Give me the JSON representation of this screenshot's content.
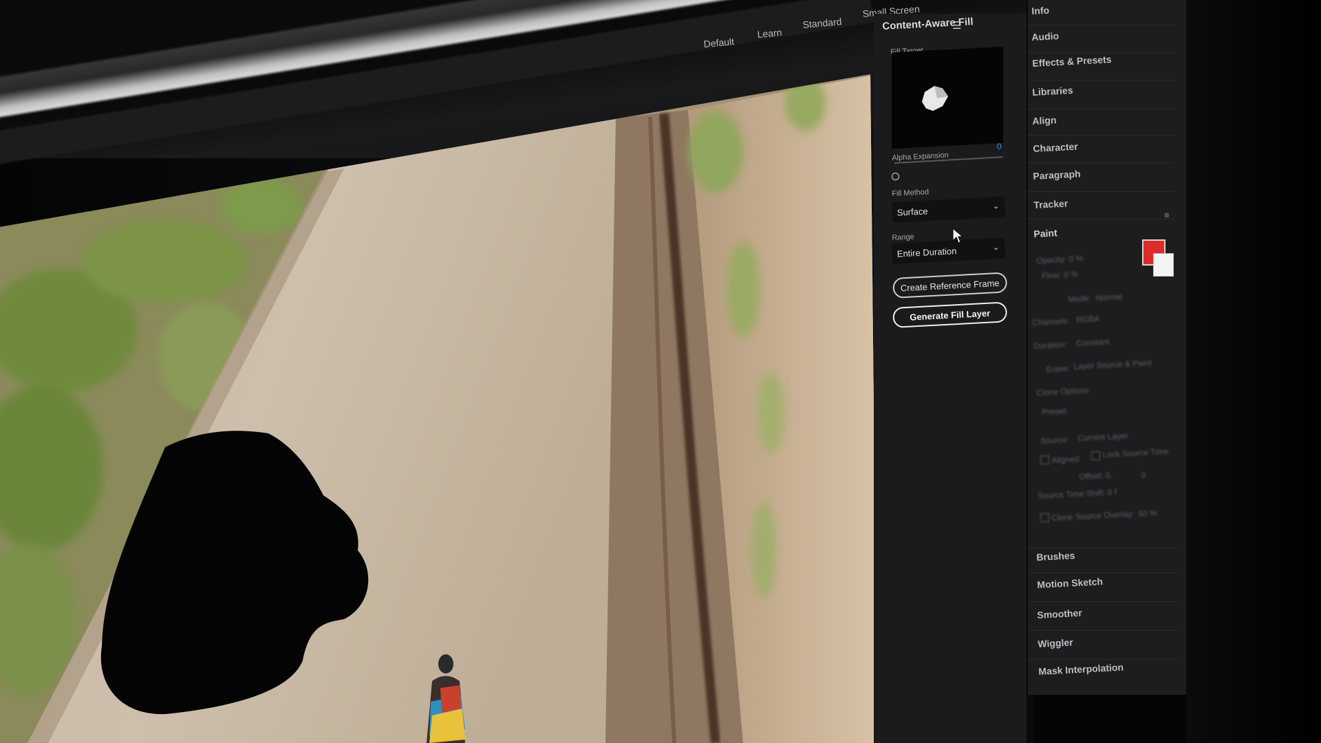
{
  "workspaces": [
    "Default",
    "Learn",
    "Standard",
    "Small Screen"
  ],
  "content_aware_fill": {
    "title": "Content-Aware Fill",
    "menu_icon": "hamburger-menu-icon",
    "fill_target_label": "Fill Target",
    "alpha_expansion_label": "Alpha Expansion",
    "alpha_expansion_value": "0",
    "fill_method_label": "Fill Method",
    "fill_method_value": "Surface",
    "range_label": "Range",
    "range_value": "Entire Duration",
    "create_reference_frame_label": "Create Reference Frame",
    "generate_fill_layer_label": "Generate Fill Layer"
  },
  "right_panel": {
    "items": [
      "Info",
      "Audio",
      "Effects & Presets",
      "Libraries",
      "Align",
      "Character",
      "Paragraph",
      "Tracker"
    ],
    "paint": {
      "title": "Paint",
      "opacity": "Opacity: 0 %",
      "flow": "Flow: 0 %",
      "mode_label": "Mode:",
      "mode_value": "Normal",
      "channels_label": "Channels:",
      "channels_value": "RGBA",
      "duration_label": "Duration:",
      "duration_value": "Constant",
      "erase_label": "Erase:",
      "erase_value": "Layer Source & Paint",
      "clone_options": "Clone Options",
      "preset_label": "Preset:",
      "source_label": "Source:",
      "source_value": "Current Layer",
      "aligned_label": "Aligned",
      "lock_source_time_label": "Lock Source Time",
      "offset_label": "Offset: 0,",
      "offset_value": "0",
      "source_time_shift": "Source Time Shift: 0 f",
      "clone_source_overlay": "Clone Source Overlay:",
      "clone_source_overlay_value": "50 %",
      "foreground_color": "#e02a2a",
      "background_color": "#f3f3f3"
    },
    "bottom_items": [
      "Brushes",
      "Motion Sketch",
      "Smoother",
      "Wiggler",
      "Mask Interpolation"
    ]
  },
  "colors": {
    "panel_bg": "#1b1b1d",
    "accent_blue": "#3d8df0"
  }
}
